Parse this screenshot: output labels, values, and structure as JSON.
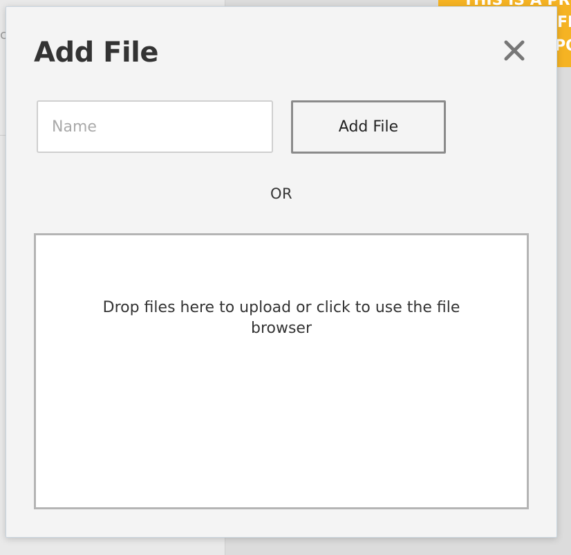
{
  "background": {
    "banner_text_lines": [
      "THIS IS A PRE",
      "FR",
      "PO"
    ],
    "stub_text": "c"
  },
  "modal": {
    "title": "Add File",
    "close_icon": "close-icon",
    "name_input": {
      "value": "",
      "placeholder": "Name"
    },
    "add_file_button_label": "Add File",
    "or_label": "OR",
    "dropzone": {
      "message": "Drop files here to upload or click to use the file browser"
    }
  },
  "colors": {
    "banner": "#f5b323",
    "modal_background": "#f4f4f4",
    "title_text": "#333333",
    "close_icon": "#777777"
  }
}
